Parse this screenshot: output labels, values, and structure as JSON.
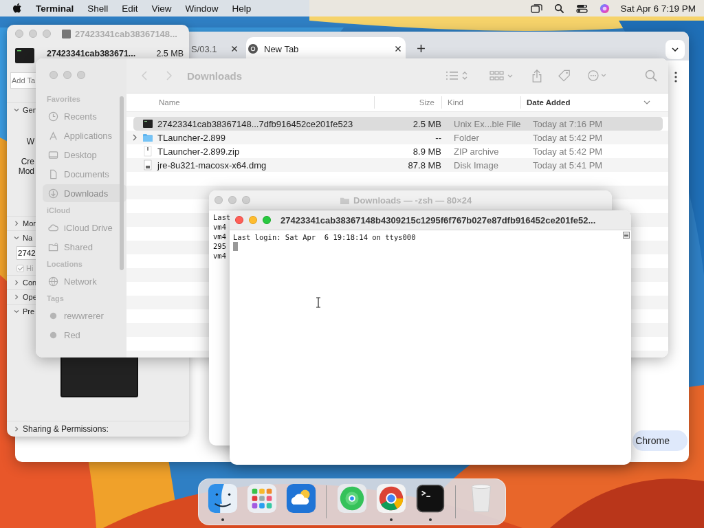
{
  "menu_bar": {
    "app": "Terminal",
    "menus": [
      "Shell",
      "Edit",
      "View",
      "Window",
      "Help"
    ],
    "clock": "Sat Apr 6  7:19 PM"
  },
  "browser": {
    "tabs": [
      {
        "label": "S/03.1",
        "selected": false
      },
      {
        "label": "New Tab",
        "selected": true
      }
    ],
    "button": "Chrome"
  },
  "info_window": {
    "title": "27423341cab38367148...",
    "name": "27423341cab383671...",
    "size": "2.5 MB",
    "tags_placeholder": "Add Ta",
    "items": [
      {
        "kind": "section",
        "label": "Gen",
        "expanded": true
      },
      {
        "kind": "label",
        "label": "W"
      },
      {
        "kind": "label",
        "label": "Cre"
      },
      {
        "kind": "label",
        "label": "Mod"
      },
      {
        "kind": "section",
        "label": "Mor",
        "expanded": false
      },
      {
        "kind": "section",
        "label": "Na",
        "expanded": true
      },
      {
        "kind": "field",
        "value": "2742"
      },
      {
        "kind": "checkbox",
        "label": "Hi",
        "checked": true
      },
      {
        "kind": "section",
        "label": "Con",
        "expanded": false
      },
      {
        "kind": "section",
        "label": "Ope",
        "expanded": false
      },
      {
        "kind": "section",
        "label": "Pre",
        "expanded": true
      },
      {
        "kind": "preview"
      },
      {
        "kind": "section",
        "label": "Sharing & Permissions:",
        "expanded": false
      }
    ]
  },
  "finder": {
    "title": "Downloads",
    "sidebar": [
      {
        "heading": "Favorites",
        "items": [
          {
            "label": "Recents",
            "selected": false
          },
          {
            "label": "Applications",
            "selected": false
          },
          {
            "label": "Desktop",
            "selected": false
          },
          {
            "label": "Documents",
            "selected": false
          },
          {
            "label": "Downloads",
            "selected": true
          }
        ]
      },
      {
        "heading": "iCloud",
        "items": [
          {
            "label": "iCloud Drive",
            "selected": false
          },
          {
            "label": "Shared",
            "selected": false
          }
        ]
      },
      {
        "heading": "Locations",
        "items": [
          {
            "label": "Network",
            "selected": false
          }
        ]
      },
      {
        "heading": "Tags",
        "items": [
          {
            "label": "rewwrerer",
            "selected": false
          },
          {
            "label": "Red",
            "selected": false
          }
        ]
      }
    ],
    "columns": [
      {
        "label": "Name",
        "sorted": false
      },
      {
        "label": "Size",
        "sorted": false
      },
      {
        "label": "Kind",
        "sorted": false
      },
      {
        "label": "Date Added",
        "sorted": true
      }
    ],
    "rows": [
      {
        "kind": "executable",
        "name": "27423341cab38367148...7dfb916452ce201fe523",
        "size": "2.5 MB",
        "file_type": "Unix Ex...ble File",
        "date": "Today at 7:16 PM",
        "expandable": false,
        "selected": true
      },
      {
        "kind": "folder",
        "name": "TLauncher-2.899",
        "size": "--",
        "file_type": "Folder",
        "date": "Today at 5:42 PM",
        "expandable": true,
        "selected": false
      },
      {
        "kind": "zip",
        "name": "TLauncher-2.899.zip",
        "size": "8.9 MB",
        "file_type": "ZIP archive",
        "date": "Today at 5:42 PM",
        "expandable": false,
        "selected": false
      },
      {
        "kind": "disk_image",
        "name": "jre-8u321-macosx-x64.dmg",
        "size": "87.8 MB",
        "file_type": "Disk Image",
        "date": "Today at 5:41 PM",
        "expandable": false,
        "selected": false
      }
    ]
  },
  "terminal_back": {
    "title": "Downloads — -zsh — 80×24",
    "lines": [
      "Last",
      "vm4",
      "vm4",
      "295",
      "vm4"
    ]
  },
  "terminal": {
    "title": "27423341cab38367148b4309215c1295f6f767b027e87dfb916452ce201fe52...",
    "lines": [
      "Last login: Sat Apr  6 19:18:14 on ttys000"
    ],
    "cursor": true
  },
  "dock": {
    "groups": [
      [
        {
          "kind": "finder",
          "running": true
        },
        {
          "kind": "launchpad",
          "running": false
        },
        {
          "kind": "weather",
          "running": false
        }
      ],
      [
        {
          "kind": "findmy",
          "running": false
        },
        {
          "kind": "chrome",
          "running": true
        },
        {
          "kind": "terminal",
          "running": true
        }
      ],
      [
        {
          "kind": "trash",
          "running": false
        }
      ]
    ]
  }
}
